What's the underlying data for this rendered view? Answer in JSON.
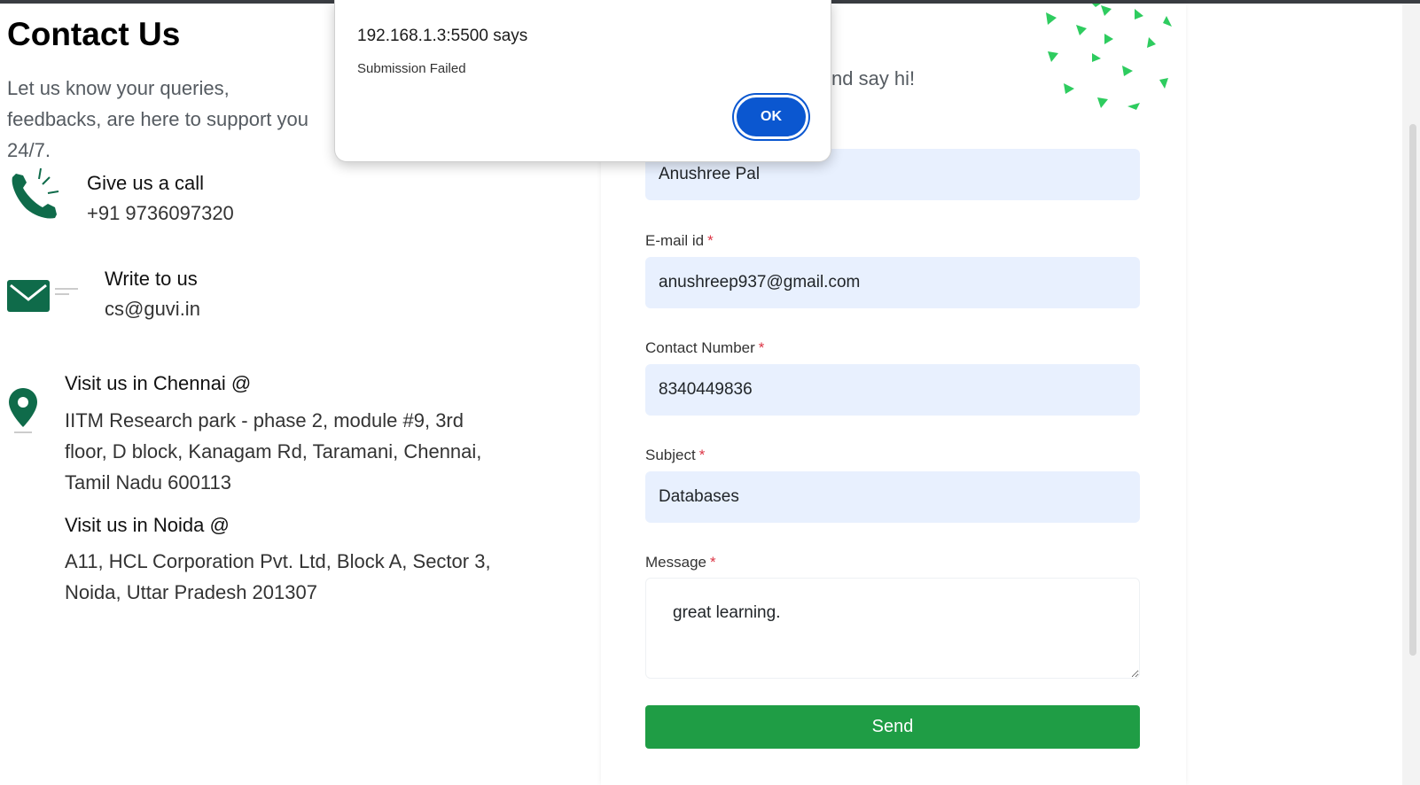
{
  "page": {
    "title": "Contact Us",
    "intro": "Let us know your queries, feedbacks, are here to support you 24/7."
  },
  "contact_info": {
    "call": {
      "title": "Give us a call",
      "value": "+91 9736097320",
      "icon": "phone-icon"
    },
    "write": {
      "title": "Write to us",
      "value": "cs@guvi.in",
      "icon": "envelope-icon"
    },
    "chennai": {
      "title": "Visit us in Chennai @",
      "address": "IITM Research park - phase 2, module #9, 3rd floor, D block, Kanagam Rd, Taramani, Chennai, Tamil Nadu 600113",
      "icon": "location-pin-icon"
    },
    "noida": {
      "title": "Visit us in Noida @",
      "address": "A11, HCL Corporation Pvt. Ltd, Block A, Sector 3, Noida, Uttar Pradesh 201307"
    }
  },
  "form": {
    "subheading": "nd say hi!",
    "required_mark": "*",
    "name": {
      "value": "Anushree Pal"
    },
    "email": {
      "label": "E-mail id",
      "value": "anushreep937@gmail.com"
    },
    "contact": {
      "label": "Contact Number",
      "value": "8340449836"
    },
    "subject": {
      "label": "Subject",
      "value": "Databases"
    },
    "message": {
      "label": "Message",
      "value": "great learning."
    },
    "send_label": "Send"
  },
  "dialog": {
    "title": "192.168.1.3:5500 says",
    "message": "Submission Failed",
    "ok_label": "OK"
  },
  "colors": {
    "brand_green": "#1f9d45",
    "icon_green": "#0f6b4a",
    "field_bg": "#e8f0fe",
    "dialog_button": "#0b57d0",
    "confetti_green": "#2ecc5f"
  }
}
